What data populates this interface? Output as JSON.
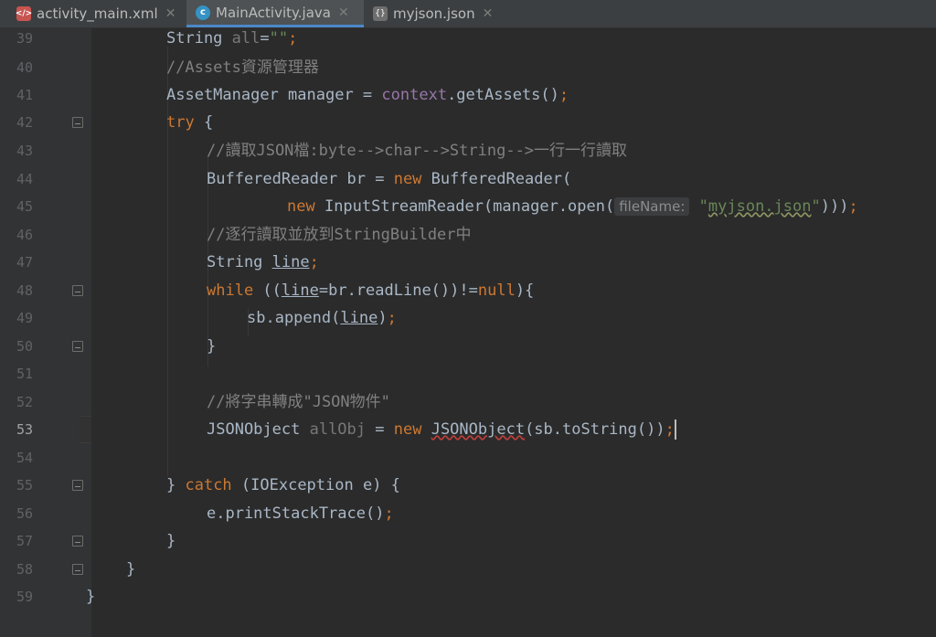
{
  "tabs": [
    {
      "label": "activity_main.xml",
      "icon": "xml-file-icon",
      "active": false
    },
    {
      "label": "MainActivity.java",
      "icon": "java-class-icon",
      "active": true
    },
    {
      "label": "myjson.json",
      "icon": "json-file-icon",
      "active": false
    }
  ],
  "line_numbers": [
    "39",
    "40",
    "41",
    "42",
    "43",
    "44",
    "45",
    "46",
    "47",
    "48",
    "49",
    "50",
    "51",
    "52",
    "53",
    "54",
    "55",
    "56",
    "57",
    "58",
    "59"
  ],
  "current_line": "53",
  "code": {
    "l39": {
      "type": "String ",
      "var": "all",
      "eq": "=",
      "str": "\"\"",
      "semi": ";"
    },
    "l40": {
      "comment": "//Assets資源管理器"
    },
    "l41": {
      "a": "AssetManager manager = ",
      "field": "context",
      "b": ".getAssets()",
      "semi": ";"
    },
    "l42": {
      "kw": "try",
      "b": " {"
    },
    "l43": {
      "comment": "//讀取JSON檔:byte-->char-->String-->一行一行讀取"
    },
    "l44": {
      "a": "BufferedReader br = ",
      "kw": "new",
      "b": " BufferedReader("
    },
    "l45": {
      "kw": "new",
      "a": " InputStreamReader(manager.open(",
      "hint": "fileName:",
      "str_q1": "\"",
      "str_val": "myjson.json",
      "str_q2": "\"",
      "b": ")))",
      "semi": ";"
    },
    "l46": {
      "comment": "//逐行讀取並放到StringBuilder中"
    },
    "l47": {
      "a": "String ",
      "var": "line",
      "semi": ";"
    },
    "l48": {
      "kw": "while",
      "a": " ((",
      "var": "line",
      "b": "=br.readLine())!=",
      "kw2": "null",
      "c": "){"
    },
    "l49": {
      "a": "sb.append(",
      "var": "line",
      "b": ")",
      "semi": ";"
    },
    "l50": {
      "a": "}"
    },
    "l52": {
      "comment": "//將字串轉成\"JSON物件\""
    },
    "l53": {
      "a": "JSONObject ",
      "var": "allObj",
      "eq": " = ",
      "kw": "new",
      "sp": " ",
      "cls": "JSONObject",
      "b": "(sb.toString())",
      "semi": ";"
    },
    "l55": {
      "a": "} ",
      "kw": "catch",
      "b": " (IOException e) {"
    },
    "l56": {
      "a": "e.printStackTrace()",
      "semi": ";"
    },
    "l57": {
      "a": "}"
    },
    "l58": {
      "a": "}"
    },
    "l59": {
      "a": "}"
    }
  },
  "colors": {
    "background": "#2b2b2b",
    "keyword": "#cc7832",
    "string": "#6a8759",
    "comment": "#808080",
    "text": "#a9b7c6",
    "field": "#9876aa"
  }
}
